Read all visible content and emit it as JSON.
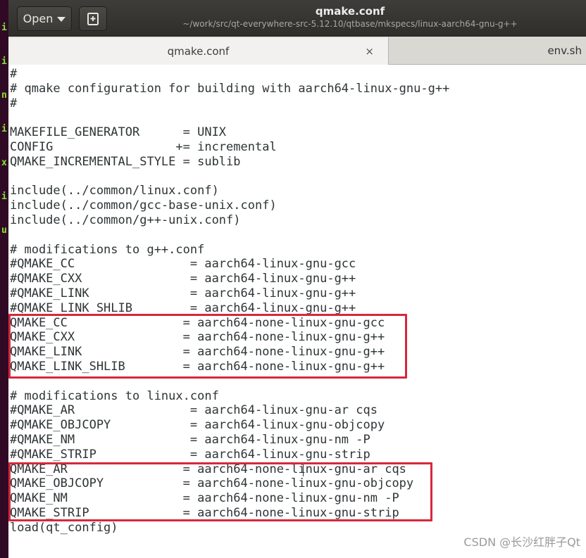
{
  "terminal": {
    "chars": [
      "i",
      "i",
      "n",
      "i",
      "x",
      "i",
      "u"
    ]
  },
  "header": {
    "open_label": "Open",
    "title": "qmake.conf",
    "subtitle": "~/work/src/qt-everywhere-src-5.12.10/qtbase/mkspecs/linux-aarch64-gnu-g++"
  },
  "tabs": [
    {
      "label": "qmake.conf",
      "close": "×"
    },
    {
      "label": "env.sh"
    }
  ],
  "code_lines": [
    "#",
    "# qmake configuration for building with aarch64-linux-gnu-g++",
    "#",
    "",
    "MAKEFILE_GENERATOR      = UNIX",
    "CONFIG                 += incremental",
    "QMAKE_INCREMENTAL_STYLE = sublib",
    "",
    "include(../common/linux.conf)",
    "include(../common/gcc-base-unix.conf)",
    "include(../common/g++-unix.conf)",
    "",
    "# modifications to g++.conf",
    "#QMAKE_CC                = aarch64-linux-gnu-gcc",
    "#QMAKE_CXX               = aarch64-linux-gnu-g++",
    "#QMAKE_LINK              = aarch64-linux-gnu-g++",
    "#QMAKE_LINK_SHLIB        = aarch64-linux-gnu-g++",
    "QMAKE_CC                = aarch64-none-linux-gnu-gcc",
    "QMAKE_CXX               = aarch64-none-linux-gnu-g++",
    "QMAKE_LINK              = aarch64-none-linux-gnu-g++",
    "QMAKE_LINK_SHLIB        = aarch64-none-linux-gnu-g++",
    "",
    "# modifications to linux.conf",
    "#QMAKE_AR                = aarch64-linux-gnu-ar cqs",
    "#QMAKE_OBJCOPY           = aarch64-linux-gnu-objcopy",
    "#QMAKE_NM                = aarch64-linux-gnu-nm -P",
    "#QMAKE_STRIP             = aarch64-linux-gnu-strip",
    "QMAKE_AR                = aarch64-none-linux-gnu-ar cqs",
    "QMAKE_OBJCOPY           = aarch64-none-linux-gnu-objcopy",
    "QMAKE_NM                = aarch64-none-linux-gnu-nm -P",
    "QMAKE_STRIP             = aarch64-none-linux-gnu-strip",
    "load(qt_config)"
  ],
  "watermark": "CSDN @长沙红胖子Qt"
}
